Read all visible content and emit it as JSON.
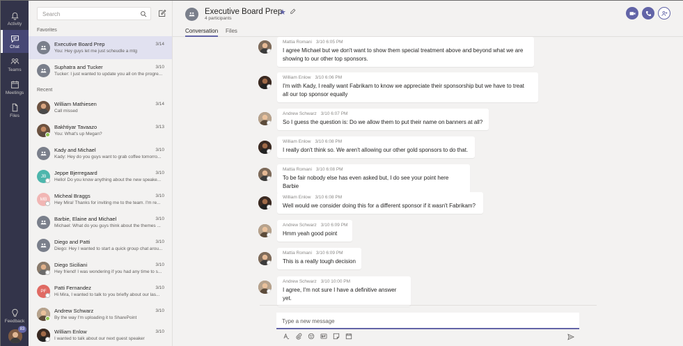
{
  "rail": {
    "items": [
      {
        "label": "Activity",
        "icon": "bell-icon"
      },
      {
        "label": "Chat",
        "icon": "chat-icon",
        "active": true
      },
      {
        "label": "Teams",
        "icon": "teams-icon"
      },
      {
        "label": "Meetings",
        "icon": "calendar-icon"
      },
      {
        "label": "Files",
        "icon": "file-icon"
      }
    ],
    "feedback_label": "Feedback",
    "badge": "83"
  },
  "chatlist": {
    "search_placeholder": "Search",
    "favorites_label": "Favorites",
    "recent_label": "Recent",
    "favorites": [
      {
        "name": "Executive Board Prep",
        "preview": "You: Hey guys let me just scheudle a mtg",
        "date": "3/14",
        "avatar": "group"
      },
      {
        "name": "Suphatra and Tucker",
        "preview": "Tucker: I just wanted to update you all on the progre...",
        "date": "3/10",
        "avatar": "group"
      }
    ],
    "recent": [
      {
        "name": "William Mathiesen",
        "preview": "Call missed",
        "date": "3/14",
        "avatar": "photo"
      },
      {
        "name": "Bakhtiyar Tavaazo",
        "preview": "You: What's up Megan?",
        "date": "3/13",
        "avatar": "photo"
      },
      {
        "name": "Kady and Michael",
        "preview": "Kady: Hey do you guys want to grab coffee tomorro...",
        "date": "3/10",
        "avatar": "group"
      },
      {
        "name": "Jeppe Bjerregaard",
        "preview": "Hello! Do you know anything about the new speake...",
        "date": "3/10",
        "avatar": "JB"
      },
      {
        "name": "Micheal Braggs",
        "preview": "Hey Mira! Thanks for inviting me to the team. I'm re...",
        "date": "3/10",
        "avatar": "MB"
      },
      {
        "name": "Barbie, Elaine and Michael",
        "preview": "Michael: What do you guys think about the themes ...",
        "date": "3/10",
        "avatar": "group"
      },
      {
        "name": "Diego and Patti",
        "preview": "Diego: Hey I wanted to start a quick group chat arou...",
        "date": "3/10",
        "avatar": "group"
      },
      {
        "name": "Diego Siciliani",
        "preview": "Hey friend! I was wondering if you had any time to s...",
        "date": "3/10",
        "avatar": "photo"
      },
      {
        "name": "Patti Fernandez",
        "preview": "Hi Mira, I wanted to talk to you briefly about our las...",
        "date": "3/10",
        "avatar": "PF"
      },
      {
        "name": "Andrew Schwarz",
        "preview": "By the way I'm uploading it to SharePoint",
        "date": "3/10",
        "avatar": "photo"
      },
      {
        "name": "William Enlow",
        "preview": "I wanted to talk about our next guest speaker",
        "date": "3/10",
        "avatar": "photo"
      }
    ]
  },
  "conversation": {
    "title": "Executive Board Prep",
    "subtitle": "4 participants",
    "tabs": [
      "Conversation",
      "Files"
    ],
    "messages": [
      {
        "author": "Mattia Romani",
        "time": "3/10 6:05 PM",
        "lines": [
          "I agree Michael but we don't want to show them special treatment above and beyond what we are",
          "showing to our other top sponsors."
        ]
      },
      {
        "author": "William Enlow",
        "time": "3/10 6:06 PM",
        "lines": [
          "I'm with Kady, I really want Fabrikam to know we appreciate their sponsorship but we have to treat",
          "all our top sponsor equally"
        ]
      },
      {
        "author": "Andrew Schwarz",
        "time": "3/10 6:07 PM",
        "lines": [
          "So I guess the question is: Do we allow them to put their name on banners at all?"
        ]
      },
      {
        "author": "William Enlow",
        "time": "3/10 6:08 PM",
        "lines": [
          "I really don't think so. We aren't allowing our other gold sponsors to do that."
        ]
      },
      {
        "author": "Mattia Romani",
        "time": "3/10 6:08 PM",
        "lines": [
          "To be fair nobody else has even asked but, I do see your point here Barbie"
        ]
      },
      {
        "author": "William Enlow",
        "time": "3/10 6:08 PM",
        "lines": [
          "Well would we consider doing this for a different sponsor if it wasn't Fabrikam?"
        ]
      },
      {
        "author": "Andrew Schwarz",
        "time": "3/10 6:09 PM",
        "lines": [
          "Hmm yeah good point"
        ]
      },
      {
        "author": "Mattia Romani",
        "time": "3/10 6:09 PM",
        "lines": [
          "This is a really tough decision"
        ]
      },
      {
        "author": "Andrew Schwarz",
        "time": "3/10 10:00 PM",
        "lines": [
          "I agree, I'm not sure I have a definitive answer yet."
        ]
      }
    ],
    "compose_placeholder": "Type a new message"
  },
  "colors": {
    "accent": "#6264a7",
    "rail": "#33344a",
    "selected": "#e1e1f0"
  }
}
